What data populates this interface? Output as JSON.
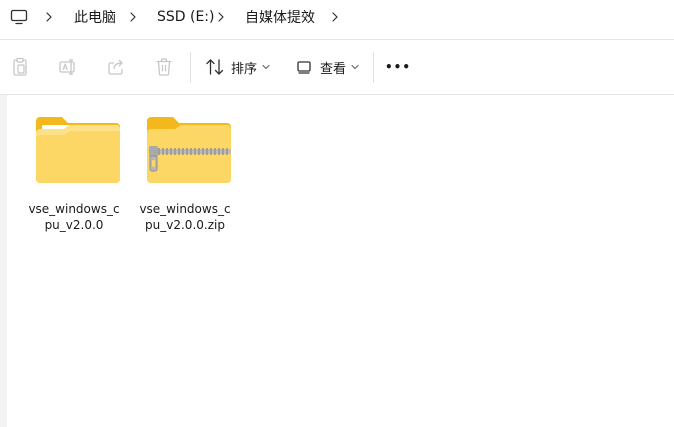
{
  "breadcrumb": {
    "items": [
      "此电脑",
      "SSD (E:)",
      "自媒体提效"
    ]
  },
  "toolbar": {
    "sort_label": "排序",
    "view_label": "查看",
    "more_label": "•••"
  },
  "files": [
    {
      "name_line1": "vse_windows_c",
      "name_line2": "pu_v2.0.0",
      "type": "folder"
    },
    {
      "name_line1": "vse_windows_c",
      "name_line2": "pu_v2.0.0.zip",
      "type": "zip-folder"
    }
  ],
  "colors": {
    "folder_back": "#f2b81c",
    "folder_front": "#fcd765",
    "folder_paper": "#ffffff",
    "zipper": "#a9a9a9",
    "icon_disabled": "#c7c7c7",
    "icon_active": "#303030"
  }
}
